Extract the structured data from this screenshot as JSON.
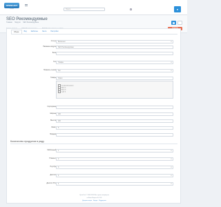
{
  "topbar": {
    "logo_text": "OPENCART",
    "logo_sub": "ocStore",
    "search_placeholder": "Поиск",
    "user_icon": "user-icon"
  },
  "header": {
    "title": "SEO Рекомендуемые",
    "breadcrumb": [
      "Главная",
      "Модули",
      "SEO Рекомендуемые"
    ],
    "status_items": [
      "Статус модуля",
      "SEO Рекомендуемые",
      "SEO Рекомендуемые товары"
    ],
    "red_button": "Удалить"
  },
  "tabs": [
    "Общие",
    "Вид",
    "Шаблоны",
    "Лента",
    "Настройки"
  ],
  "fields": [
    {
      "label": "Статус",
      "value": "Включено",
      "type": "select"
    },
    {
      "label": "Название модуля",
      "value": "SEO Рекомендуемые",
      "type": "input"
    },
    {
      "label": "Блок",
      "value": "",
      "type": "input"
    },
    {
      "label": "Тип",
      "value": "Товары",
      "type": "select"
    },
    {
      "label": "Показать ссылки",
      "value": "Нет",
      "type": "select"
    },
    {
      "label": "Товары",
      "value": "Поиск",
      "type": "input"
    }
  ],
  "stores": [
    "Основной магазин",
    "Store 2",
    "Store 3",
    "Сайт 4"
  ],
  "fields2": [
    {
      "label": "Сортировка",
      "value": "",
      "type": "input"
    },
    {
      "label": "Ширина",
      "value": "200",
      "type": "input"
    },
    {
      "label": "Высота",
      "value": "200",
      "type": "input"
    },
    {
      "label": "Лимит",
      "value": "5",
      "type": "input"
    },
    {
      "label": "Порядок",
      "value": "",
      "type": "input"
    },
    {
      "label": "Колонок",
      "value": "",
      "type": "select"
    }
  ],
  "section2": {
    "title": "Количество продуктов в ряду",
    "rows": [
      {
        "label": "Мобильный",
        "value": "1",
        "type": "select"
      },
      {
        "label": "Планшет",
        "value": "2",
        "type": "select"
      },
      {
        "label": "Ноутбук",
        "value": "3",
        "type": "select"
      },
      {
        "label": "Десктоп",
        "value": "4",
        "type": "select"
      },
      {
        "label": "Десктоп XXL",
        "value": "4",
        "type": "select"
      }
    ]
  },
  "footer": {
    "line1": "OpenCart © 2009-2024 Все права защищены",
    "line2": "ocStore Версия 3.0.3.8",
    "line3": "Документация · Форум · Поддержка"
  }
}
